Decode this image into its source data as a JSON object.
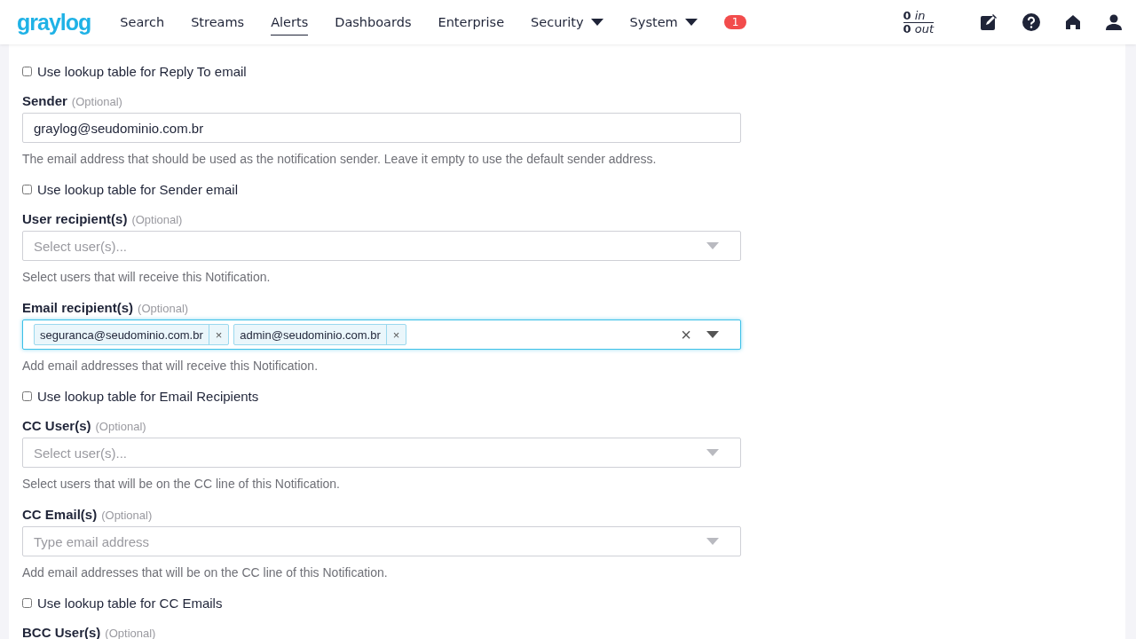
{
  "navbar": {
    "logo": "graylog",
    "items": [
      {
        "label": "Search",
        "selected": false,
        "dropdown": false
      },
      {
        "label": "Streams",
        "selected": false,
        "dropdown": false
      },
      {
        "label": "Alerts",
        "selected": true,
        "dropdown": false
      },
      {
        "label": "Dashboards",
        "selected": false,
        "dropdown": false
      },
      {
        "label": "Enterprise",
        "selected": false,
        "dropdown": false
      },
      {
        "label": "Security",
        "selected": false,
        "dropdown": true
      },
      {
        "label": "System",
        "selected": false,
        "dropdown": true
      }
    ],
    "notification_count": "1",
    "throughput": {
      "in_count": "0",
      "in_label": "in",
      "out_count": "0",
      "out_label": "out"
    }
  },
  "form": [
    {
      "kind": "checkbox",
      "label": "Use lookup table for Reply To email",
      "checked": false
    },
    {
      "kind": "text",
      "label": "Sender",
      "optional": "(Optional)",
      "value": "graylog@seudominio.com.br",
      "help": "The email address that should be used as the notification sender. Leave it empty to use the default sender address."
    },
    {
      "kind": "checkbox",
      "label": "Use lookup table for Sender email",
      "checked": false
    },
    {
      "kind": "select",
      "label": "User recipient(s)",
      "optional": "(Optional)",
      "placeholder": "Select user(s)...",
      "help": "Select users that will receive this Notification."
    },
    {
      "kind": "tags",
      "label": "Email recipient(s)",
      "optional": "(Optional)",
      "focused": true,
      "tags": [
        "seguranca@seudominio.com.br",
        "admin@seudominio.com.br"
      ],
      "remove": "×",
      "clear": "×",
      "help": "Add email addresses that will receive this Notification."
    },
    {
      "kind": "checkbox",
      "label": "Use lookup table for Email Recipients",
      "checked": false
    },
    {
      "kind": "select",
      "label": "CC User(s)",
      "optional": "(Optional)",
      "placeholder": "Select user(s)...",
      "help": "Select users that will be on the CC line of this Notification."
    },
    {
      "kind": "select",
      "label": "CC Email(s)",
      "optional": "(Optional)",
      "placeholder": "Type email address",
      "help": "Add email addresses that will be on the CC line of this Notification."
    },
    {
      "kind": "checkbox",
      "label": "Use lookup table for CC Emails",
      "checked": false
    },
    {
      "kind": "heading",
      "label": "BCC User(s)",
      "optional": "(Optional)"
    }
  ]
}
